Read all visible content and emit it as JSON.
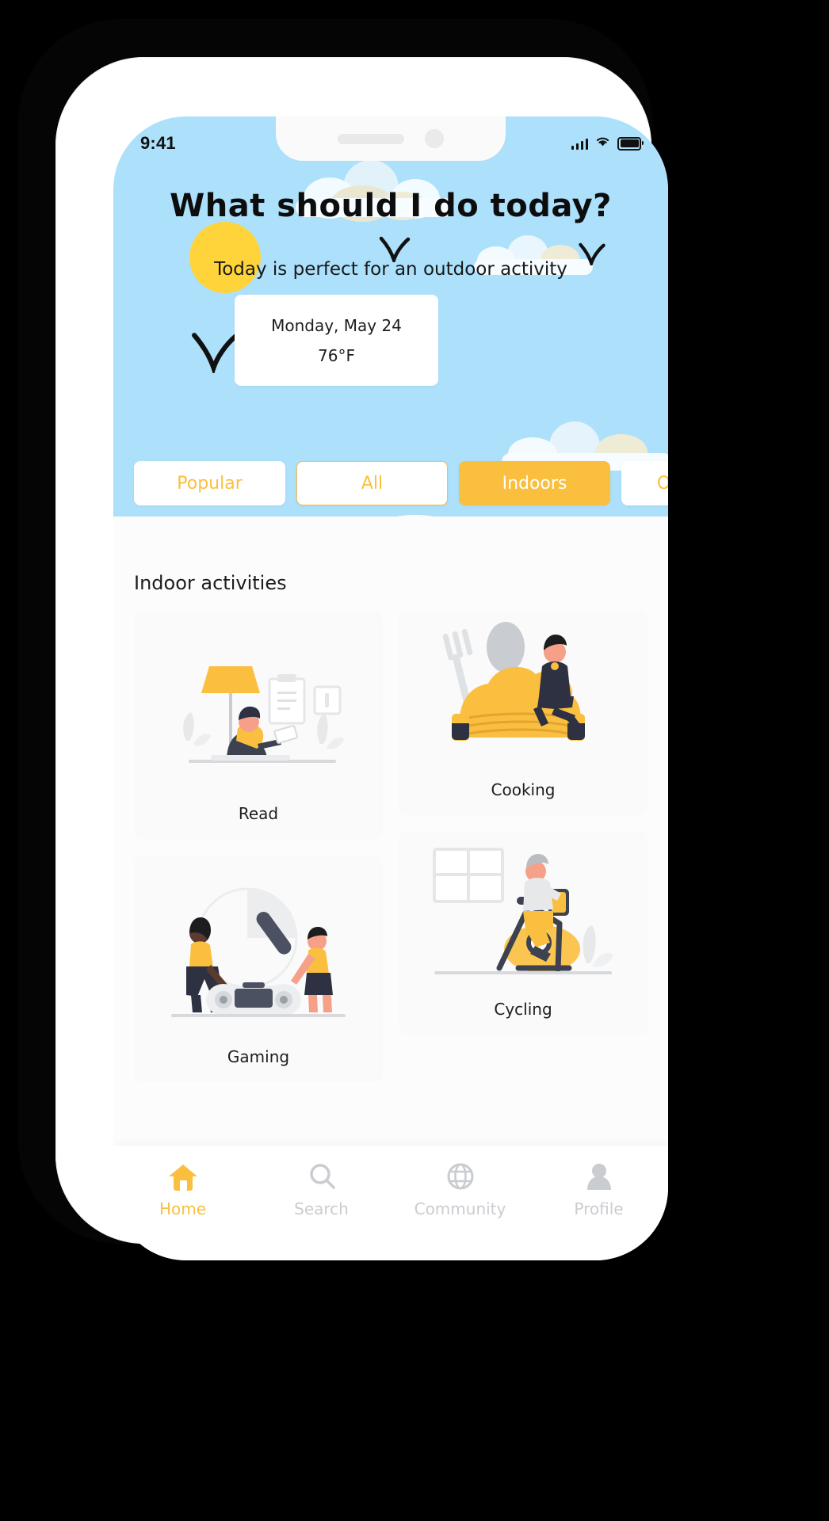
{
  "status_bar": {
    "time": "9:41",
    "icons": [
      "signal-bars-icon",
      "wifi-icon",
      "battery-icon"
    ]
  },
  "header": {
    "title": "What should I do today?",
    "subtitle": "Today is perfect for an outdoor activity",
    "sun_icon": "sun-icon",
    "bird_icons": [
      "bird-icon",
      "bird-icon",
      "bird-icon"
    ],
    "weather_card": {
      "date": "Monday, May 24",
      "temperature": "76°F"
    }
  },
  "filters": {
    "chips": [
      {
        "label": "Popular",
        "style": "plain"
      },
      {
        "label": "All",
        "style": "outlined"
      },
      {
        "label": "Indoors",
        "style": "filled"
      },
      {
        "label": "Outdoors",
        "style": "plain"
      }
    ],
    "selected": "Indoors"
  },
  "main": {
    "section_title": "Indoor activities",
    "cards": [
      {
        "label": "Read",
        "art": "reading-illustration"
      },
      {
        "label": "Cooking",
        "art": "cooking-illustration"
      },
      {
        "label": "Gaming",
        "art": "gaming-illustration"
      },
      {
        "label": "Cycling",
        "art": "indoor-cycling-illustration"
      }
    ]
  },
  "tabbar": {
    "items": [
      {
        "label": "Home",
        "icon": "home-icon",
        "active": true
      },
      {
        "label": "Search",
        "icon": "search-icon",
        "active": false
      },
      {
        "label": "Community",
        "icon": "globe-icon",
        "active": false
      },
      {
        "label": "Profile",
        "icon": "person-icon",
        "active": false
      }
    ]
  },
  "colors": {
    "accent": "#FBBF3F",
    "sky": "#ACE0FB",
    "sun": "#FFD43B",
    "text": "#1B1D1F",
    "muted": "#C9CCD0",
    "card_bg": "#FAFAFA",
    "screen_bg": "#FCFCFC"
  }
}
